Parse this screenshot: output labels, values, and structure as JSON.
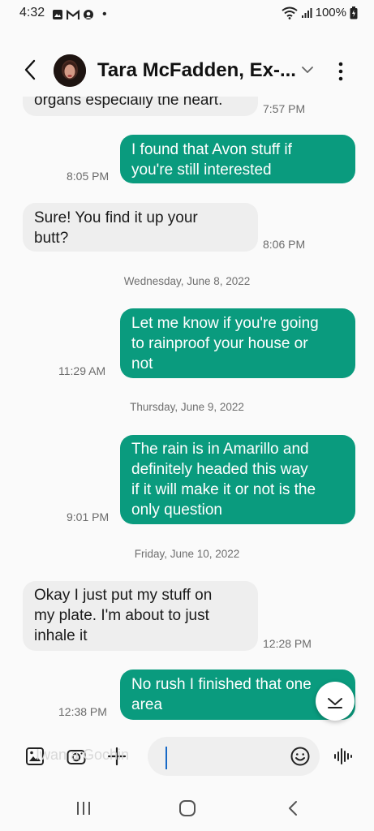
{
  "status_bar": {
    "time": "4:32",
    "dot": "•",
    "battery": "100%",
    "left_icons": [
      "image-icon",
      "gmail-icon",
      "face-icon"
    ],
    "right_icons": [
      "wifi-icon",
      "signal-icon",
      "battery-icon"
    ]
  },
  "header": {
    "contact_name": "Tara McFadden, Ex-...",
    "icons": [
      "back-arrow-icon",
      "avatar",
      "chevron-down-icon",
      "more-vert-icon"
    ]
  },
  "messages": [
    {
      "direction": "in",
      "text": "organs especially the heart.",
      "time": "7:57 PM"
    },
    {
      "direction": "out",
      "text": "I found that Avon stuff if\nyou're still interested",
      "time": "8:05 PM"
    },
    {
      "direction": "in",
      "text": "Sure! You find it up your\nbutt?",
      "time": "8:06 PM"
    },
    {
      "type": "date",
      "text": "Wednesday, June 8, 2022"
    },
    {
      "direction": "out",
      "text": "Let me know if you're going\nto rainproof your house or\nnot",
      "time": "11:29 AM"
    },
    {
      "type": "date",
      "text": "Thursday, June 9, 2022"
    },
    {
      "direction": "out",
      "text": "The rain is in Amarillo and\ndefinitely headed this way\nif it will make it or not is the\nonly question",
      "time": "9:01 PM"
    },
    {
      "type": "date",
      "text": "Friday, June 10, 2022"
    },
    {
      "direction": "in",
      "text": "Okay I just put my stuff on\nmy plate. I'm about to just\ninhale it",
      "time": "12:28 PM"
    },
    {
      "direction": "out",
      "text": "No rush I finished that one\narea",
      "time": "12:38 PM"
    }
  ],
  "composer": {
    "placeholder": "Iwan a Gochin",
    "icons": [
      "gallery-icon",
      "camera-icon",
      "plus-icon",
      "emoji-icon",
      "voice-icon"
    ]
  },
  "scroll_down": {
    "icon": "chevron-down-icon"
  },
  "navbar": {
    "icons": [
      "recents-icon",
      "home-icon",
      "back-icon"
    ]
  },
  "colors": {
    "outgoing_bubble": "#0a9b7e",
    "incoming_bubble": "#eeeeee",
    "background": "#fafafa",
    "cursor": "#1769c6"
  }
}
